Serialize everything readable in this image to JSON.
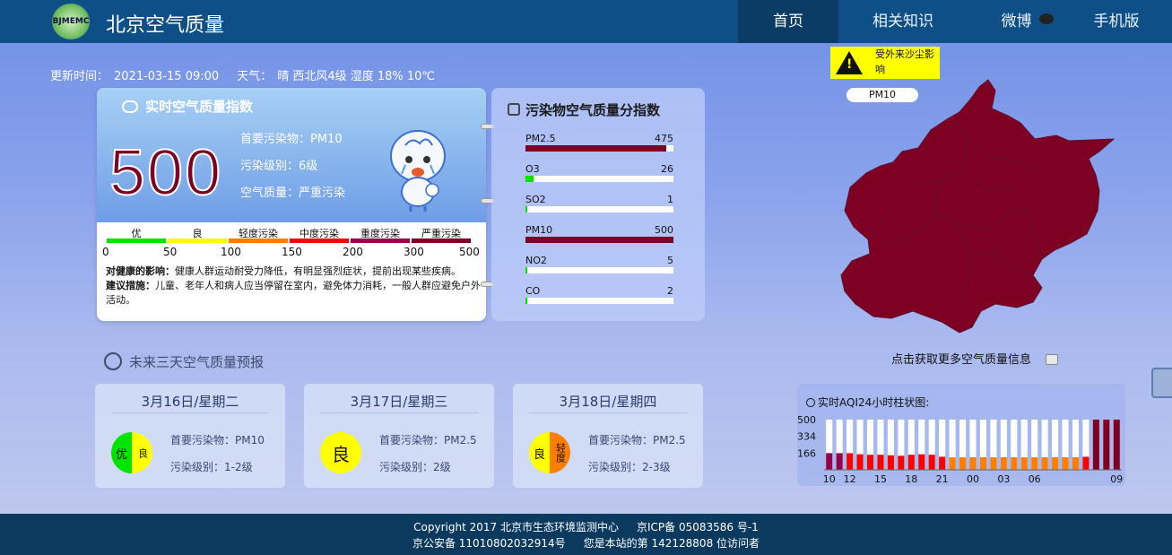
{
  "header": {
    "logo_text": "BJMEMC",
    "title": "北京空气质量",
    "nav": {
      "home": "首页",
      "knowledge": "相关知识",
      "weibo": "微博",
      "mobile": "手机版"
    }
  },
  "update": {
    "label": "更新时间：",
    "time": "2021-03-15 09:00",
    "weather_label": "天气：",
    "weather": "晴 西北风4级 湿度 18% 10℃"
  },
  "aqi": {
    "heading": "实时空气质量指数",
    "value": "500",
    "primary": "首要污染物：PM10",
    "level": "污染级别：6级",
    "quality": "空气质量：严重污染",
    "scale": {
      "labels": [
        "优",
        "良",
        "轻度污染",
        "中度污染",
        "重度污染",
        "严重污染"
      ],
      "colors": [
        "#00e400",
        "#ffff00",
        "#ff7e00",
        "#ff0000",
        "#99004c",
        "#7e0023"
      ],
      "ticks": [
        "0",
        "50",
        "100",
        "150",
        "200",
        "300",
        "500"
      ]
    },
    "health_label": "对健康的影响：",
    "health_text": "健康人群运动耐受力降低，有明显强烈症状，提前出现某些疾病。",
    "advice_label": "建议措施：",
    "advice_text": "儿童、老年人和病人应当停留在室内，避免体力消耗，一般人群应避免户外活动。"
  },
  "pollutants": {
    "heading": "污染物空气质量分指数",
    "items": [
      {
        "name": "PM2.5",
        "value": 475,
        "label": "475",
        "color": "#7e0023"
      },
      {
        "name": "O3",
        "value": 26,
        "label": "26",
        "color": "#00e400"
      },
      {
        "name": "SO2",
        "value": 1,
        "label": "1",
        "color": "#00e400"
      },
      {
        "name": "PM10",
        "value": 500,
        "label": "500",
        "color": "#7e0023"
      },
      {
        "name": "NO2",
        "value": 5,
        "label": "5",
        "color": "#00e400"
      },
      {
        "name": "CO",
        "value": 2,
        "label": "2",
        "color": "#00e400"
      }
    ],
    "max": 500
  },
  "forecast": {
    "title": "未来三天空气质量预报",
    "days": [
      {
        "date": "3月16日/星期二",
        "badge_left": "优",
        "badge_right": "良",
        "color_left": "#00e400",
        "color_right": "#ffff00",
        "primary": "首要污染物：PM10",
        "level": "污染级别：1-2级"
      },
      {
        "date": "3月17日/星期三",
        "badge_left": "良",
        "badge_right": "",
        "color_left": "#ffff00",
        "color_right": "#ffff00",
        "primary": "首要污染物：PM2.5",
        "level": "污染级别：2级"
      },
      {
        "date": "3月18日/星期四",
        "badge_left": "良",
        "badge_right": "轻度",
        "color_left": "#ffff00",
        "color_right": "#ff7e00",
        "primary": "首要污染物：PM2.5",
        "level": "污染级别：2-3级"
      }
    ]
  },
  "map": {
    "alert": "受外来沙尘影响",
    "pollutant_tag": "PM10",
    "fill_color": "#7e0023",
    "link": "点击获取更多空气质量信息"
  },
  "chart_data": {
    "type": "bar",
    "title": "实时AQI24小时柱状图:",
    "y_ticks": [
      "500",
      "334",
      "166"
    ],
    "ylim": [
      0,
      500
    ],
    "x_tick_labels": [
      "10",
      "12",
      "15",
      "18",
      "21",
      "00",
      "03",
      "06",
      "09"
    ],
    "values": [
      166,
      166,
      166,
      155,
      150,
      150,
      145,
      140,
      150,
      155,
      150,
      130,
      125,
      125,
      125,
      125,
      125,
      125,
      125,
      125,
      125,
      125,
      125,
      125,
      125,
      130,
      500,
      500,
      500
    ],
    "colors": [
      "#99004c",
      "#99004c",
      "#ff0000",
      "#ff0000",
      "#ff0000",
      "#ff0000",
      "#ff0000",
      "#ff0000",
      "#ff0000",
      "#ff0000",
      "#ff0000",
      "#ff0000",
      "#ff7e00",
      "#ff7e00",
      "#ff7e00",
      "#ff7e00",
      "#ff7e00",
      "#ff7e00",
      "#ff7e00",
      "#ff7e00",
      "#ff7e00",
      "#ff7e00",
      "#ff7e00",
      "#ff7e00",
      "#ff7e00",
      "#ff0000",
      "#7e0023",
      "#7e0023",
      "#7e0023"
    ]
  },
  "footer": {
    "copyright": "Copyright 2017 北京市生态环境监测中心",
    "icp": "京ICP备 05083586 号-1",
    "police": "京公安备 11010802032914号",
    "visitors": "您是本站的第 142128808 位访问者"
  }
}
